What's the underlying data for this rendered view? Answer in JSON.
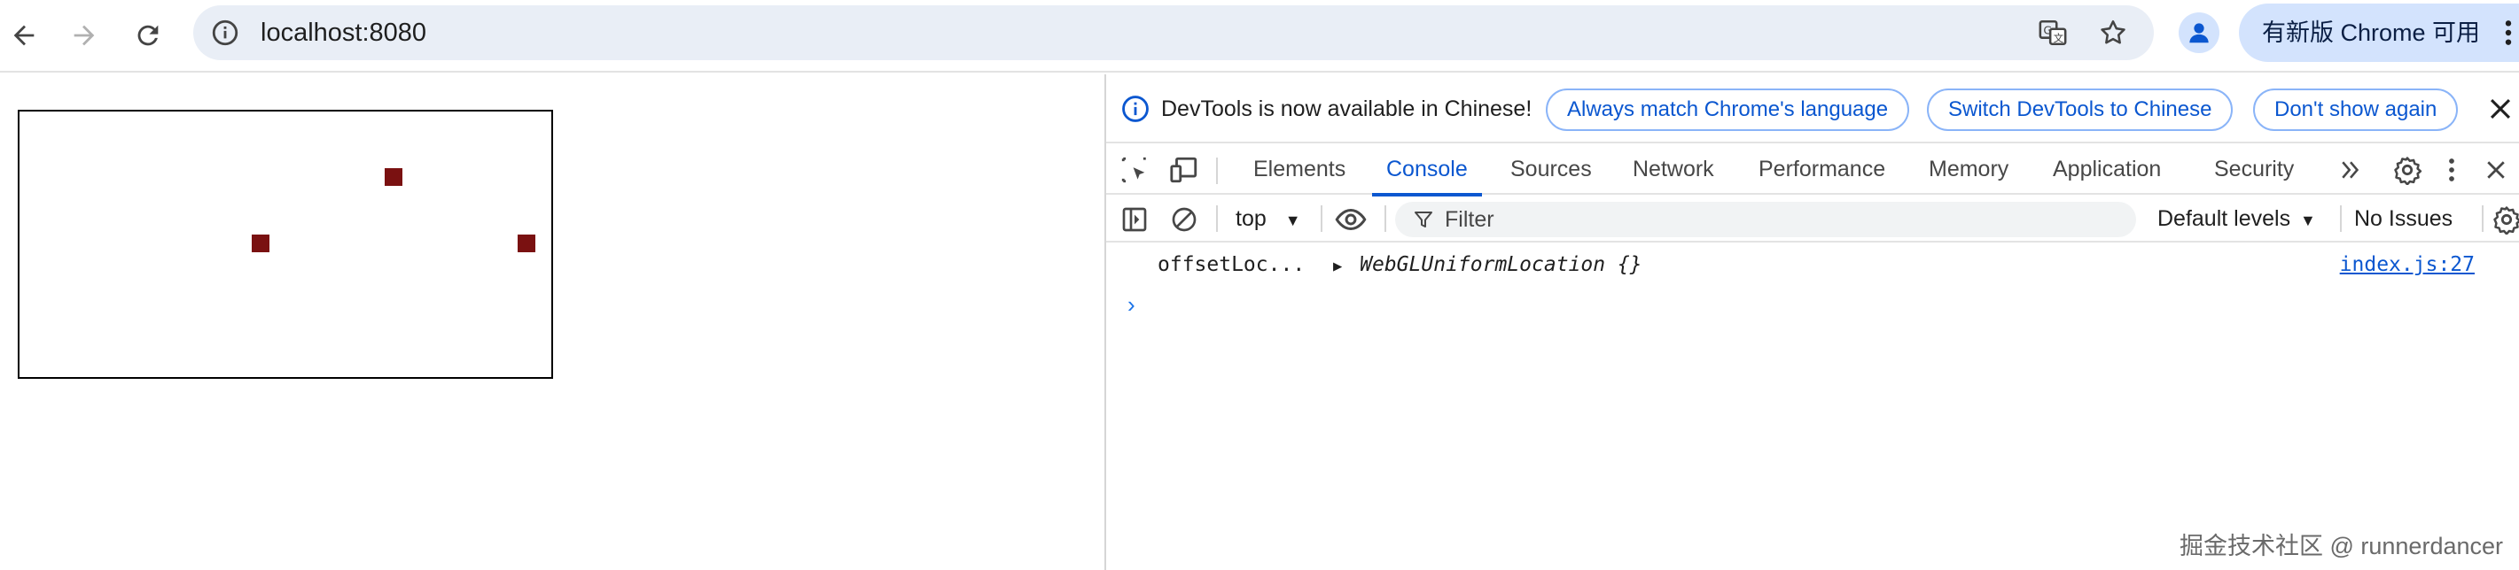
{
  "browser": {
    "url": "localhost:8080",
    "update_button": "有新版 Chrome 可用",
    "icons": [
      "back-icon",
      "forward-icon",
      "reload-icon",
      "info-icon",
      "translate-icon",
      "star-icon",
      "profile-icon",
      "kebab-icon"
    ]
  },
  "page": {
    "points_label": "WebGL canvas with three points"
  },
  "devtools": {
    "infobar": {
      "message": "DevTools is now available in Chinese!",
      "buttons": [
        "Always match Chrome's language",
        "Switch DevTools to Chinese",
        "Don't show again"
      ]
    },
    "tabs": [
      "Elements",
      "Console",
      "Sources",
      "Network",
      "Performance",
      "Memory",
      "Application",
      "Security"
    ],
    "active_tab": "Console",
    "filterbar": {
      "context": "top",
      "filter_placeholder": "Filter",
      "levels": "Default levels",
      "issues": "No Issues"
    },
    "console": {
      "messages": [
        {
          "label": "offsetLoc...",
          "value": "WebGLUniformLocation {}",
          "source": "index.js:27"
        }
      ],
      "prompt": "›"
    }
  },
  "watermark": "掘金技术社区 @ runnerdancer",
  "colors": {
    "accent": "#0b57d0",
    "point_color": "#7a1111",
    "omnibox_bg": "#e9eef6",
    "update_pill_bg": "#d3e3fd"
  }
}
